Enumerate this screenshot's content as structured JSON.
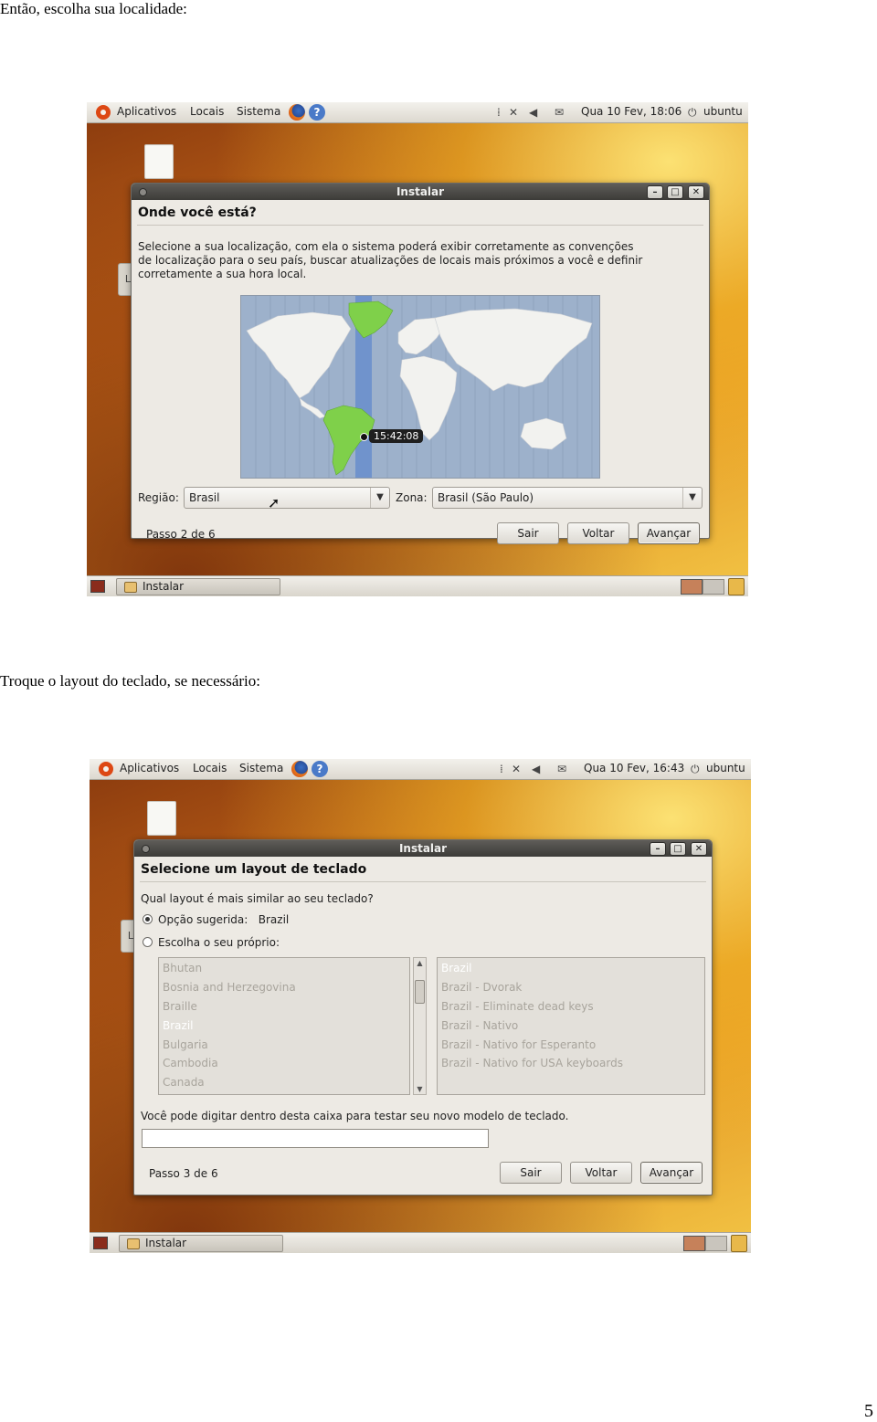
{
  "doc": {
    "text1": "Então, escolha sua localidade:",
    "text2": "Troque o layout do teclado, se necessário:",
    "page_number": "5"
  },
  "panel": {
    "menu_apps": "Aplicativos",
    "menu_places": "Locais",
    "menu_system": "Sistema",
    "help": "?",
    "user": "ubuntu"
  },
  "shot1": {
    "clock": "Qua 10 Fev, 18:06",
    "window_title": "Instalar",
    "heading": "Onde você está?",
    "description": "Selecione a sua localização, com ela o sistema poderá exibir corretamente as convenções de localização para o seu país, buscar atualizações de locais mais próximos a você e definir corretamente a sua hora local.",
    "time_tooltip": "15:42:08",
    "region_label": "Região:",
    "region_value": "Brasil",
    "zone_label": "Zona:",
    "zone_value": "Brasil (São Paulo)",
    "step": "Passo 2 de 6",
    "quit": "Sair",
    "back": "Voltar",
    "forward": "Avançar",
    "taskbar_item": "Instalar"
  },
  "shot2": {
    "clock": "Qua 10 Fev, 16:43",
    "window_title": "Instalar",
    "heading": "Selecione um layout de teclado",
    "question": "Qual layout é mais similar ao seu teclado?",
    "suggested_label": "Opção sugerida:",
    "suggested_value": "Brazil",
    "choose_label": "Escolha o seu próprio:",
    "countries": [
      "Bhutan",
      "Bosnia and Herzegovina",
      "Braille",
      "Brazil",
      "Bulgaria",
      "Cambodia",
      "Canada"
    ],
    "selected_country": "Brazil",
    "layouts": [
      "Brazil",
      "Brazil - Dvorak",
      "Brazil - Eliminate dead keys",
      "Brazil - Nativo",
      "Brazil - Nativo for Esperanto",
      "Brazil - Nativo for USA keyboards"
    ],
    "selected_layout": "Brazil",
    "test_label": "Você pode digitar dentro desta caixa para testar seu novo modelo de teclado.",
    "test_value": "",
    "step": "Passo 3 de 6",
    "quit": "Sair",
    "back": "Voltar",
    "forward": "Avançar",
    "taskbar_item": "Instalar"
  },
  "icons": {
    "ubuntu": "ubuntu-logo-icon",
    "firefox": "firefox-icon",
    "help": "help-icon",
    "network": "network-icon",
    "volume": "volume-icon",
    "mail": "mail-icon",
    "power": "power-icon",
    "trash": "trash-icon"
  },
  "colors": {
    "tz_highlight": "#7093cc",
    "map_water": "#9db1cb",
    "selected_land": "#7fd04a",
    "desktop_orange": "#e59a26"
  }
}
